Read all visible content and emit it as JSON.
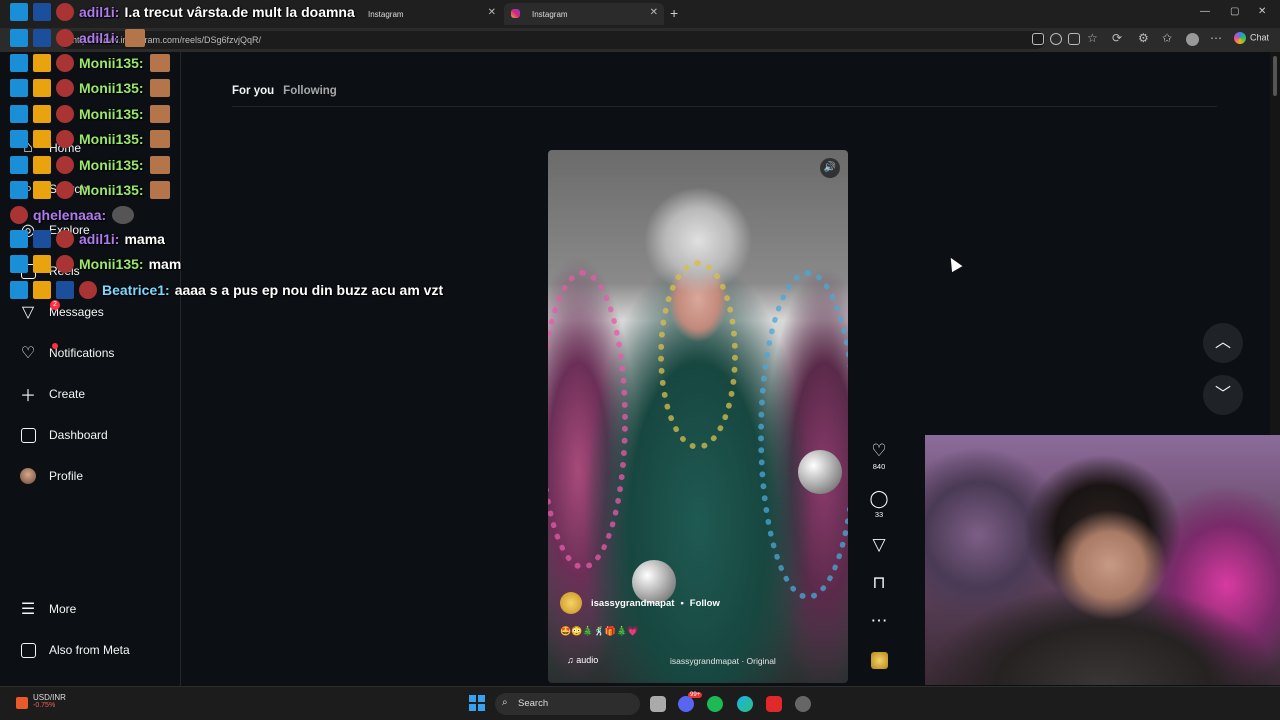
{
  "browser": {
    "tabs": [
      {
        "label": "I.a trecut vârsta.de mult la doamna",
        "active": false
      },
      {
        "label": "Instagram",
        "active": false
      },
      {
        "label": "Instagram",
        "active": true
      }
    ],
    "new_tab": "+",
    "url": "https://www.instagram.com/reels/DSg6fzvjQqR/",
    "chat_label": "Chat",
    "window_controls": [
      "—",
      "▢",
      "✕"
    ]
  },
  "sidebar": {
    "items": [
      {
        "label": "Home",
        "icon": "home-icon"
      },
      {
        "label": "Search",
        "icon": "search-icon"
      },
      {
        "label": "Explore",
        "icon": "compass-icon"
      },
      {
        "label": "Reels",
        "icon": "reels-icon"
      },
      {
        "label": "Messages",
        "icon": "messenger-icon",
        "badge": "2"
      },
      {
        "label": "Notifications",
        "icon": "heart-icon"
      },
      {
        "label": "Create",
        "icon": "plus-icon"
      },
      {
        "label": "Dashboard",
        "icon": "dashboard-icon"
      },
      {
        "label": "Profile",
        "icon": "avatar"
      }
    ],
    "bottom": [
      {
        "label": "More",
        "icon": "menu-icon"
      },
      {
        "label": "Also from Meta",
        "icon": "meta-icon"
      }
    ]
  },
  "feed": {
    "tab_for_you": "For you",
    "tab_following": "Following"
  },
  "reel": {
    "username": "isassygrandmapat",
    "separator": "•",
    "follow": "Follow",
    "caption_emojis": "🤩😳🎄🕺🎁🎄💗",
    "audio_label": "audio",
    "audio_source": "isassygrandmapat · Original",
    "likes": "840",
    "comments": "33"
  },
  "chat_overlay": [
    {
      "user": "adil1i:",
      "msg": "I.a trecut vârsta.de mult la doamna",
      "color": "purple"
    },
    {
      "user": "adil1i:",
      "msg": "",
      "color": "purple"
    },
    {
      "user": "Monii135:",
      "msg": "",
      "color": "green"
    },
    {
      "user": "Monii135:",
      "msg": "",
      "color": "green"
    },
    {
      "user": "Monii135:",
      "msg": "",
      "color": "green"
    },
    {
      "user": "Monii135:",
      "msg": "",
      "color": "green"
    },
    {
      "user": "Monii135:",
      "msg": "",
      "color": "green"
    },
    {
      "user": "Monii135:",
      "msg": "",
      "color": "green"
    },
    {
      "user": "qhelenaaa:",
      "msg": "",
      "color": "purple"
    },
    {
      "user": "adil1i:",
      "msg": "mama",
      "color": "purple"
    },
    {
      "user": "Monii135:",
      "msg": "mam",
      "color": "green"
    },
    {
      "user": "Beatrice1:",
      "msg": "aaaa s a pus ep nou din buzz acu am vzt",
      "color": "cyan"
    }
  ],
  "taskbar": {
    "widget_title": "USD/INR",
    "widget_change": "-0.75%",
    "search_label": "Search",
    "notification_badge": "99+"
  },
  "colors": {
    "accent_red": "#ff3040",
    "ig_bg": "#0c1014",
    "chat_green": "#9be96b",
    "chat_purple": "#b07af0"
  }
}
